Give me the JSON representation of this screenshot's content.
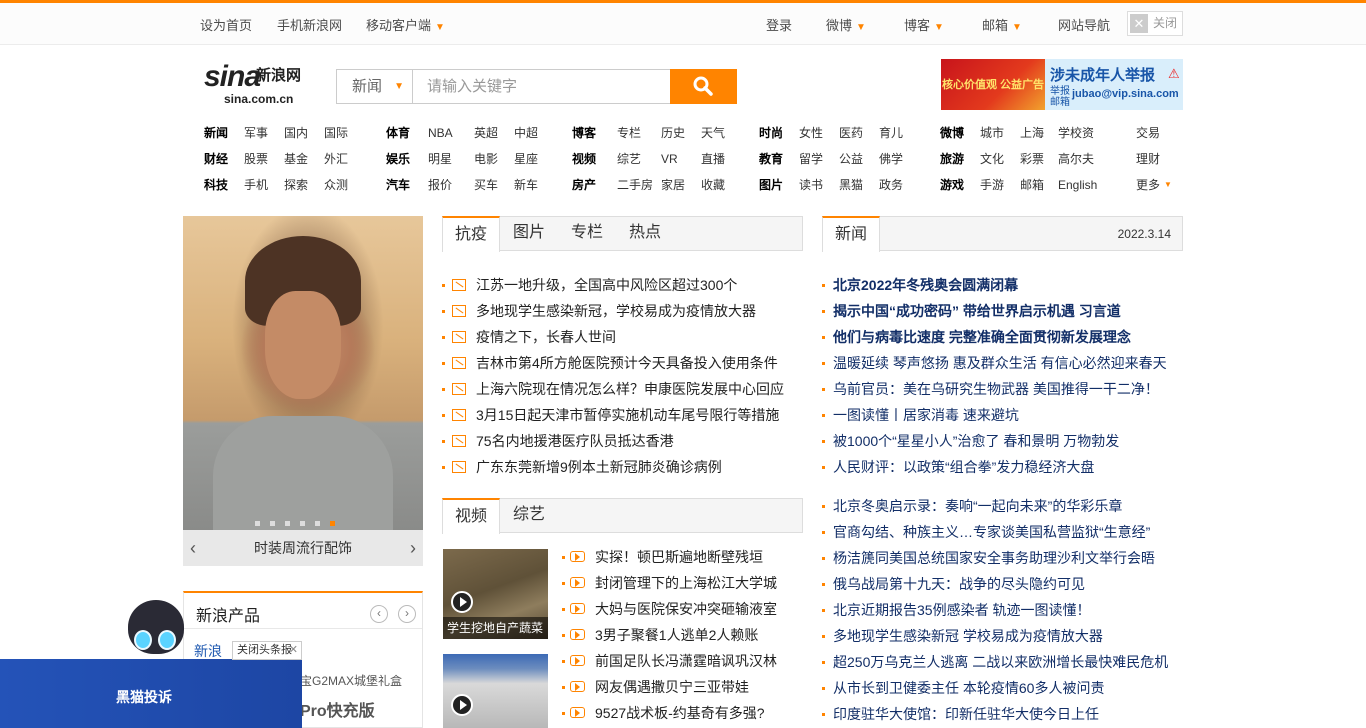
{
  "topbar": {
    "left": [
      "设为首页",
      "手机新浪网",
      "移动客户端"
    ],
    "right": [
      "登录",
      "微博",
      "博客",
      "邮箱",
      "网站导航"
    ],
    "close_label": "关闭"
  },
  "logo": {
    "brand": "sina",
    "brand_cn": "新浪网",
    "domain": "sina.com.cn"
  },
  "search": {
    "category": "新闻",
    "placeholder": "请输入关键字"
  },
  "ad_banner": {
    "left_text": "核心价值观 公益广告",
    "title": "涉未成年人举报",
    "tag": "举报 邮箱",
    "email": "jubao@vip.sina.com"
  },
  "nav": [
    [
      [
        "新闻",
        "军事",
        "国内",
        "国际"
      ],
      [
        "财经",
        "股票",
        "基金",
        "外汇"
      ],
      [
        "科技",
        "手机",
        "探索",
        "众测"
      ]
    ],
    [
      [
        "体育",
        "NBA",
        "英超",
        "中超"
      ],
      [
        "娱乐",
        "明星",
        "电影",
        "星座"
      ],
      [
        "汽车",
        "报价",
        "买车",
        "新车"
      ]
    ],
    [
      [
        "博客",
        "专栏",
        "历史",
        "天气"
      ],
      [
        "视频",
        "综艺",
        "VR",
        "直播"
      ],
      [
        "房产",
        "二手房",
        "家居",
        "收藏"
      ]
    ],
    [
      [
        "时尚",
        "女性",
        "医药",
        "育儿"
      ],
      [
        "教育",
        "留学",
        "公益",
        "佛学"
      ],
      [
        "图片",
        "读书",
        "黑猫",
        "政务"
      ]
    ],
    [
      [
        "微博",
        "城市",
        "上海",
        "学校资"
      ],
      [
        "旅游",
        "文化",
        "彩票",
        "高尔夫"
      ],
      [
        "游戏",
        "手游",
        "邮箱",
        "English"
      ]
    ],
    [
      [
        "交易"
      ],
      [
        "理财"
      ],
      [
        "更多"
      ]
    ]
  ],
  "slideshow": {
    "caption": "时装周流行配饰",
    "dots": 6,
    "active_dot": 6
  },
  "products": {
    "title": "新浪产品",
    "first_item": "新浪",
    "line2": "宝G2MAX城堡礼盒",
    "line3": "Pro快充版"
  },
  "float_ad": {
    "close_label": "关闭头条报",
    "brand": "黑猫投诉"
  },
  "covid_tabs": [
    "抗疫",
    "图片",
    "专栏",
    "热点"
  ],
  "covid_news": [
    "江苏一地升级，全国高中风险区超过300个",
    "多地现学生感染新冠，学校易成为疫情放大器",
    "疫情之下，长春人世间",
    "吉林市第4所方舱医院预计今天具备投入使用条件",
    "上海六院现在情况怎么样？申康医院发展中心回应",
    "3月15日起天津市暂停实施机动车尾号限行等措施",
    "75名内地援港医疗队员抵达香港",
    "广东东莞新增9例本土新冠肺炎确诊病例"
  ],
  "video_tabs": [
    "视频",
    "综艺"
  ],
  "video_thumbs": [
    "学生挖地自产蔬菜",
    ""
  ],
  "video_news": [
    "实探！顿巴斯遍地断壁残垣",
    "封闭管理下的上海松江大学城",
    "大妈与医院保安冲突砸输液室",
    "3男子聚餐1人逃单2人赖账",
    "前国足队长冯潇霆暗讽巩汉林",
    "网友偶遇撒贝宁三亚带娃",
    "9527战术板-约基奇有多强?"
  ],
  "news_tab": "新闻",
  "news_date": "2022.3.14",
  "news_headlines": [
    "北京2022年冬残奥会圆满闭幕",
    "揭示中国“成功密码” 带给世界启示机遇 习言道",
    "他们与病毒比速度 完整准确全面贯彻新发展理念"
  ],
  "news_list1": [
    "温暖延续 琴声悠扬 惠及群众生活 有信心必然迎来春天",
    "乌前官员：美在乌研究生物武器 美国推得一干二净！",
    "一图读懂丨居家消毒 速来避坑",
    "被1000个“星星小人”治愈了 春和景明 万物勃发",
    "人民财评：以政策“组合拳”发力稳经济大盘"
  ],
  "news_list2": [
    "北京冬奥启示录：奏响“一起向未来”的华彩乐章",
    "官商勾结、种族主义…专家谈美国私营监狱“生意经”",
    "杨洁篪同美国总统国家安全事务助理沙利文举行会晤",
    "俄乌战局第十九天：战争的尽头隐约可见",
    "北京近期报告35例感染者 轨迹一图读懂！",
    "多地现学生感染新冠 学校易成为疫情放大器",
    "超250万乌克兰人逃离 二战以来欧洲增长最快难民危机",
    "从市长到卫健委主任 本轮疫情60多人被问责",
    "印度驻华大使馆：印新任驻华大使今日上任"
  ],
  "colors": {
    "accent": "#ff8400",
    "headline": "#122e67"
  }
}
